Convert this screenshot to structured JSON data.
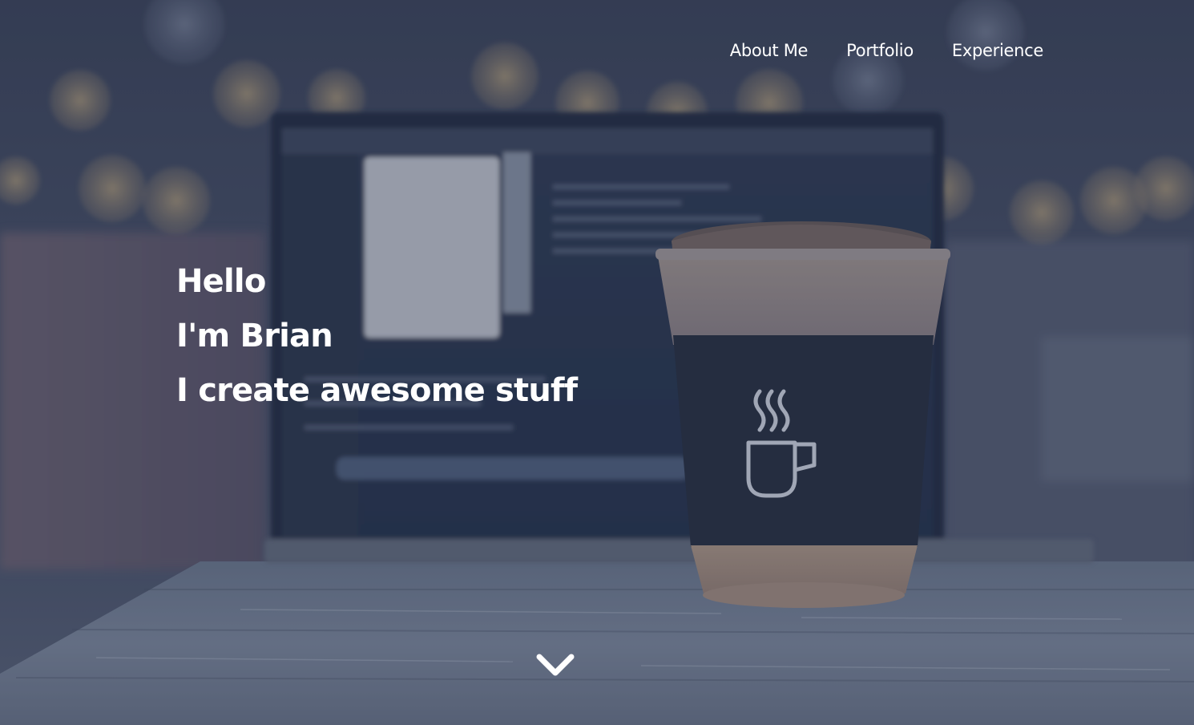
{
  "nav": {
    "items": [
      {
        "label": "About Me"
      },
      {
        "label": "Portfolio"
      },
      {
        "label": "Experience"
      }
    ]
  },
  "hero": {
    "lines": [
      "Hello",
      "I'm Brian",
      "I create awesome stuff"
    ],
    "scroll_icon": "chevron-down-icon",
    "background": "blurred photo of a laptop and a takeaway coffee cup on a wooden table",
    "overlay_color": "#262e48",
    "text_color": "#ffffff"
  }
}
